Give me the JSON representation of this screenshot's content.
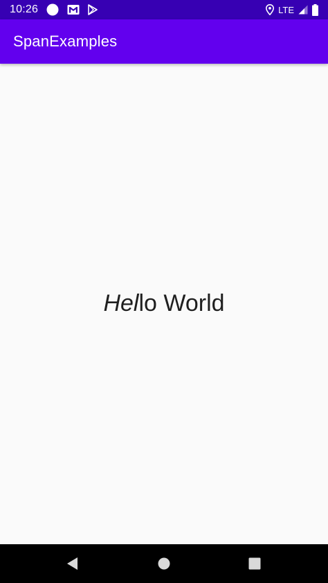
{
  "status_bar": {
    "time": "10:26",
    "network": "LTE",
    "icons": [
      "circle-notification-icon",
      "gmail-icon",
      "play-store-icon",
      "location-icon",
      "signal-icon",
      "battery-icon"
    ]
  },
  "app_bar": {
    "title": "SpanExamples",
    "color": "#6200ee",
    "status_color": "#3700b3"
  },
  "content": {
    "text_italic": "Hel",
    "text_regular": "lo World"
  },
  "nav_bar": {
    "buttons": [
      "back-icon",
      "home-icon",
      "recents-icon"
    ]
  }
}
